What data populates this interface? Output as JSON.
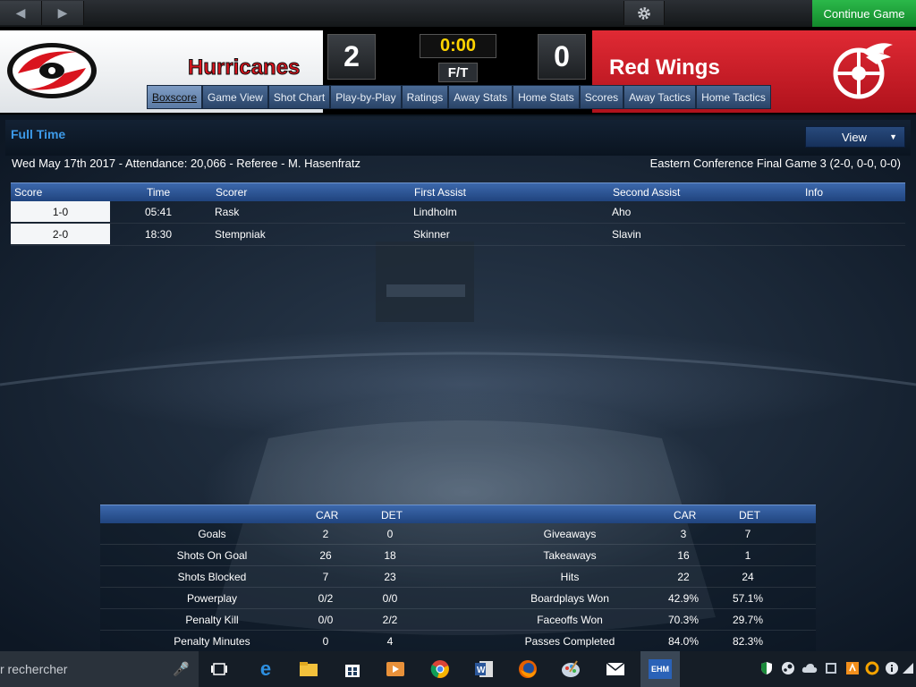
{
  "topbar": {
    "back_icon": "back-arrow-icon",
    "forward_icon": "forward-arrow-icon",
    "settings_icon": "gear-icon",
    "continue_label": "Continue Game",
    "continue_color": "#1fa43c"
  },
  "header": {
    "home_team": "Hurricanes",
    "away_team": "Red Wings",
    "home_score": "2",
    "away_score": "0",
    "clock": "0:00",
    "period": "F/T",
    "home_color": "#d9141e",
    "away_color": "#ce1126",
    "home_logo_icon": "hurricanes-logo",
    "away_logo_icon": "red-wings-logo"
  },
  "tabs": [
    {
      "label": "Boxscore",
      "active": true
    },
    {
      "label": "Game View"
    },
    {
      "label": "Shot Chart"
    },
    {
      "label": "Play-by-Play"
    },
    {
      "label": "Ratings"
    },
    {
      "label": "Away Stats"
    },
    {
      "label": "Home Stats"
    },
    {
      "label": "Scores"
    },
    {
      "label": "Away Tactics"
    },
    {
      "label": "Home Tactics"
    }
  ],
  "panel": {
    "title": "Full Time",
    "view_label": "View",
    "game_info": "Wed May 17th 2017 - Attendance: 20,066 - Referee - M. Hasenfratz",
    "series_info": "Eastern Conference Final Game 3 (2-0, 0-0, 0-0)"
  },
  "goals_table": {
    "headers": [
      "Score",
      "Time",
      "Scorer",
      "First Assist",
      "Second Assist",
      "Info"
    ],
    "rows": [
      {
        "score": "1-0",
        "time": "05:41",
        "scorer": "Rask",
        "first_assist": "Lindholm",
        "second_assist": "Aho",
        "info": ""
      },
      {
        "score": "2-0",
        "time": "18:30",
        "scorer": "Stempniak",
        "first_assist": "Skinner",
        "second_assist": "Slavin",
        "info": ""
      }
    ]
  },
  "stats": {
    "home_abbr": "CAR",
    "away_abbr": "DET",
    "left": [
      {
        "label": "Goals",
        "car": "2",
        "det": "0"
      },
      {
        "label": "Shots On Goal",
        "car": "26",
        "det": "18"
      },
      {
        "label": "Shots Blocked",
        "car": "7",
        "det": "23"
      },
      {
        "label": "Powerplay",
        "car": "0/2",
        "det": "0/0"
      },
      {
        "label": "Penalty Kill",
        "car": "0/0",
        "det": "2/2"
      },
      {
        "label": "Penalty Minutes",
        "car": "0",
        "det": "4"
      }
    ],
    "right": [
      {
        "label": "Giveaways",
        "car": "3",
        "det": "7"
      },
      {
        "label": "Takeaways",
        "car": "16",
        "det": "1"
      },
      {
        "label": "Hits",
        "car": "22",
        "det": "24"
      },
      {
        "label": "Boardplays Won",
        "car": "42.9%",
        "det": "57.1%"
      },
      {
        "label": "Faceoffs Won",
        "car": "70.3%",
        "det": "29.7%"
      },
      {
        "label": "Passes Completed",
        "car": "84.0%",
        "det": "82.3%"
      }
    ]
  },
  "taskbar": {
    "search_placeholder": "r rechercher",
    "apps": [
      "task-view-icon",
      "edge-icon",
      "file-explorer-icon",
      "store-icon",
      "media-player-icon",
      "chrome-icon",
      "word-icon",
      "firefox-icon",
      "paint-icon",
      "mail-icon",
      "ehm-icon"
    ],
    "ehm_label": "EHM",
    "word_label": "W",
    "tray": [
      "shield-icon",
      "steam-icon",
      "cloud-icon",
      "app-icon",
      "app-icon-2",
      "update-icon",
      "info-icon",
      "network-icon"
    ]
  }
}
